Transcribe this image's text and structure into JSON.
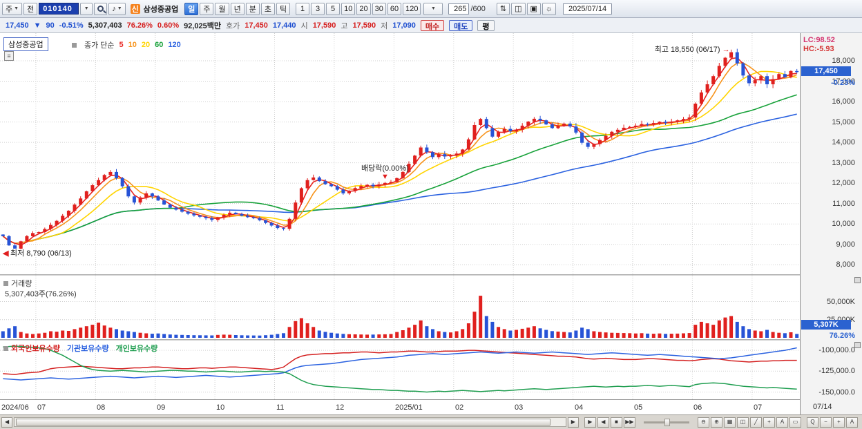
{
  "glyphs": {
    "dropdown": "▼",
    "speaker": "♪",
    "menu": "≡",
    "scroll_left": "◀",
    "scroll_right": "▶"
  },
  "toolbar": {
    "period_dropdown": "주",
    "prev_button": "전",
    "code": "010140",
    "flag_badge": "신",
    "stock_name": "삼성중공업",
    "periods": [
      "일",
      "주",
      "월",
      "년",
      "분",
      "초",
      "틱"
    ],
    "active_period": "일",
    "intervals": [
      "1",
      "3",
      "5",
      "10",
      "20",
      "30",
      "60",
      "120"
    ],
    "count": "265",
    "count_total": "/600",
    "date": "2025/07/14",
    "icons": [
      {
        "name": "compare-icon",
        "glyph": "⇅"
      },
      {
        "name": "chart-type-icon",
        "glyph": "◫"
      },
      {
        "name": "save-icon",
        "glyph": "▣"
      },
      {
        "name": "settings-gear-icon",
        "glyph": "☼"
      }
    ]
  },
  "quotebar": {
    "price": "17,450",
    "arrow": "▼",
    "change": "90",
    "change_pct": "-0.51%",
    "volume": "5,307,403",
    "vol_ratio": "76.26%",
    "turnover_pct": "0.60%",
    "value": "92,025백만",
    "hoga_label": "호가",
    "ask": "17,450",
    "bid": "17,440",
    "open_label": "시",
    "open": "17,590",
    "high_label": "고",
    "high": "17,590",
    "low_label": "저",
    "low": "17,090",
    "buy_label": "매수",
    "sell_label": "매도",
    "avg_label": "평"
  },
  "panes": {
    "price": {
      "title": "삼성중공업",
      "legend_label": "종가 단순"
    },
    "volume": {
      "title": "거래량",
      "subtitle": "5,307,403주(76.26%)"
    },
    "ownership": {
      "legends": [
        "외국인보유수량",
        "기관보유수량",
        "개인보유수량"
      ]
    }
  },
  "indicators": {
    "lc": "LC:98.52",
    "lc_color": "#d4326e",
    "hc": "HC:-5.93",
    "hc_color": "#d43232"
  },
  "axis_boxes": {
    "price": {
      "raw": 17450,
      "value": "17,450",
      "pct": "-0.23%"
    },
    "volume": {
      "raw": 5307,
      "value": "5,307K",
      "pct": "76.26%"
    }
  },
  "bottombar": {
    "nav": [
      {
        "name": "play-button",
        "glyph": "▶"
      },
      {
        "name": "step-back-button",
        "glyph": "◀"
      },
      {
        "name": "stop-button",
        "glyph": "■"
      },
      {
        "name": "step-forward-button",
        "glyph": "▶▶"
      }
    ],
    "tools": [
      {
        "name": "zoom-out-range-icon",
        "glyph": "⊖"
      },
      {
        "name": "zoom-in-range-icon",
        "glyph": "⊕"
      },
      {
        "name": "grid-icon",
        "glyph": "▦"
      },
      {
        "name": "chart-style-icon",
        "glyph": "◫"
      },
      {
        "name": "trendline-icon",
        "glyph": "╱"
      },
      {
        "name": "crosshair-icon",
        "glyph": "+"
      },
      {
        "name": "text-tool-icon",
        "glyph": "A"
      },
      {
        "name": "shape-tool-icon",
        "glyph": "▭"
      }
    ],
    "zoom": [
      {
        "name": "magnifier-button",
        "glyph": "Q"
      },
      {
        "name": "zoom-out-button",
        "glyph": "−"
      },
      {
        "name": "zoom-in-button",
        "glyph": "+"
      },
      {
        "name": "auto-scale-button",
        "glyph": "A"
      }
    ]
  },
  "chart_data": {
    "type": "candlestick",
    "panes": [
      "candlestick+moving-averages",
      "volume-bars",
      "ownership-lines"
    ],
    "symbol": "삼성중공업",
    "code": "010140",
    "last_date": "07/14",
    "price_axis": {
      "min": 7600,
      "max": 18950,
      "ticks": [
        8000,
        9000,
        10000,
        11000,
        12000,
        13000,
        14000,
        15000,
        16000,
        17000,
        18000
      ]
    },
    "volume_axis": {
      "max": 80000,
      "ticks": [
        25000,
        50000
      ]
    },
    "ownership_axis": {
      "min": -157000,
      "max": -90000,
      "ticks": [
        -100000,
        -125000,
        -150000
      ],
      "tick_labels": [
        "-100,000.0",
        "-125,000.0",
        "-150,000.0"
      ]
    },
    "months": [
      {
        "label": "2024/06",
        "start": 0
      },
      {
        "label": "07",
        "start": 6
      },
      {
        "label": "08",
        "start": 16
      },
      {
        "label": "09",
        "start": 26
      },
      {
        "label": "10",
        "start": 36
      },
      {
        "label": "11",
        "start": 46
      },
      {
        "label": "12",
        "start": 56
      },
      {
        "label": "2025/01",
        "start": 66
      },
      {
        "label": "02",
        "start": 76
      },
      {
        "label": "03",
        "start": 86
      },
      {
        "label": "04",
        "start": 96
      },
      {
        "label": "05",
        "start": 106
      },
      {
        "label": "06",
        "start": 116
      },
      {
        "label": "07",
        "start": 126
      }
    ],
    "open_first": 9480,
    "closes": [
      9400,
      8950,
      8790,
      9150,
      9400,
      9550,
      9600,
      9750,
      9950,
      10150,
      10400,
      10650,
      10950,
      11250,
      11600,
      11900,
      12150,
      12400,
      12550,
      12250,
      11850,
      11350,
      11050,
      11300,
      11500,
      11350,
      11150,
      10950,
      10800,
      10700,
      10600,
      10500,
      10420,
      10350,
      10280,
      10200,
      10320,
      10450,
      10550,
      10480,
      10400,
      10330,
      10280,
      10180,
      10050,
      9920,
      9800,
      9760,
      10250,
      11050,
      11750,
      12150,
      12280,
      12100,
      11950,
      11850,
      11680,
      11500,
      11620,
      11760,
      11860,
      11920,
      11850,
      11940,
      12010,
      12060,
      12250,
      12550,
      12950,
      13350,
      13750,
      13520,
      13280,
      13420,
      13310,
      13360,
      13450,
      13650,
      14150,
      14850,
      15150,
      14700,
      14280,
      14520,
      14660,
      14540,
      14620,
      14820,
      15020,
      15160,
      15080,
      14880,
      14700,
      14820,
      14920,
      14780,
      14480,
      13980,
      13780,
      13920,
      14120,
      14320,
      14520,
      14620,
      14720,
      14760,
      14820,
      14900,
      14860,
      14950,
      15010,
      14960,
      15020,
      15080,
      15150,
      15220,
      15900,
      16450,
      16850,
      17250,
      17750,
      18150,
      18420,
      17880,
      17280,
      16900,
      17050,
      17250,
      16850,
      17100,
      17350,
      17200,
      17500,
      17450
    ],
    "high_override": {
      "122": 18550
    },
    "low_override": {
      "2": 8790
    },
    "volumes_k": [
      9000,
      13000,
      16000,
      8000,
      6000,
      5200,
      6000,
      7000,
      9000,
      8500,
      10000,
      9500,
      12000,
      14000,
      16000,
      18000,
      21000,
      17000,
      14000,
      12000,
      10000,
      9000,
      8000,
      7000,
      6200,
      5600,
      6000,
      5200,
      4600,
      4200,
      4000,
      3800,
      3600,
      3500,
      3400,
      3300,
      4000,
      4400,
      4200,
      3800,
      3500,
      3300,
      3200,
      3100,
      3600,
      4200,
      5200,
      6400,
      15000,
      23000,
      27000,
      20000,
      15000,
      10000,
      8200,
      7000,
      6000,
      5400,
      5000,
      4800,
      4600,
      4400,
      4500,
      4700,
      4900,
      5200,
      8000,
      10500,
      14000,
      18000,
      24000,
      16000,
      12000,
      9000,
      8000,
      7400,
      9000,
      12000,
      20000,
      36000,
      58000,
      30000,
      22000,
      15000,
      12000,
      10000,
      11000,
      12500,
      14000,
      16000,
      13000,
      11000,
      9200,
      8600,
      8000,
      7400,
      10000,
      14000,
      12000,
      9000,
      8000,
      7400,
      7000,
      6800,
      6600,
      6400,
      6000,
      6400,
      5800,
      5600,
      6000,
      5400,
      5600,
      5800,
      6200,
      6600,
      18000,
      22000,
      20000,
      18000,
      24000,
      28000,
      30000,
      22000,
      16000,
      12000,
      10000,
      9000,
      11000,
      8000,
      7000,
      6400,
      7600,
      5307
    ],
    "ownership": {
      "foreign": [
        -128000,
        -128500,
        -129000,
        -128000,
        -127000,
        -126500,
        -126000,
        -124000,
        -122000,
        -121000,
        -120500,
        -120000,
        -119500,
        -119000,
        -119500,
        -120000,
        -120500,
        -121000,
        -121500,
        -122000,
        -122000,
        -121500,
        -121000,
        -121000,
        -120500,
        -120000,
        -120000,
        -120500,
        -121000,
        -121500,
        -122000,
        -122000,
        -121500,
        -121000,
        -121000,
        -121500,
        -121000,
        -120500,
        -120000,
        -120000,
        -120500,
        -121000,
        -121500,
        -122000,
        -122500,
        -123000,
        -122000,
        -120000,
        -115000,
        -110000,
        -107000,
        -105500,
        -105000,
        -104500,
        -104000,
        -104000,
        -103500,
        -103000,
        -103000,
        -102500,
        -102000,
        -102000,
        -102500,
        -103000,
        -102500,
        -102000,
        -102000,
        -101500,
        -101000,
        -101000,
        -101500,
        -102000,
        -102000,
        -101500,
        -101000,
        -101000,
        -101000,
        -100500,
        -100000,
        -100000,
        -100500,
        -101000,
        -101500,
        -102000,
        -102500,
        -103000,
        -103500,
        -104000,
        -104500,
        -105000,
        -105500,
        -106000,
        -106500,
        -107000,
        -107000,
        -107500,
        -108000,
        -109000,
        -110000,
        -110500,
        -110000,
        -109500,
        -110000,
        -110500,
        -111000,
        -111000,
        -111000,
        -110500,
        -110000,
        -110000,
        -110500,
        -111000,
        -111500,
        -112000,
        -112000,
        -112500,
        -112000,
        -111000,
        -110500,
        -110000,
        -110500,
        -111500,
        -112500,
        -113000,
        -113500,
        -114000,
        -113500,
        -113000,
        -113000,
        -112500,
        -112500,
        -112000,
        -112000,
        -112000
      ],
      "institution": [
        -134000,
        -134500,
        -135000,
        -135500,
        -135000,
        -134500,
        -134000,
        -133500,
        -133000,
        -133500,
        -134000,
        -134500,
        -134000,
        -133500,
        -133000,
        -132500,
        -132000,
        -131500,
        -131000,
        -131500,
        -132000,
        -132500,
        -133000,
        -132500,
        -132000,
        -131500,
        -131000,
        -131500,
        -132000,
        -132500,
        -132000,
        -131500,
        -131000,
        -130500,
        -130000,
        -130500,
        -131000,
        -131500,
        -132000,
        -131500,
        -131000,
        -130500,
        -130000,
        -129500,
        -129000,
        -128500,
        -128000,
        -127000,
        -124000,
        -121000,
        -119000,
        -118000,
        -117500,
        -117000,
        -116500,
        -116000,
        -115000,
        -114000,
        -113000,
        -112000,
        -111000,
        -110500,
        -110000,
        -109500,
        -109000,
        -108500,
        -108000,
        -107000,
        -106000,
        -105500,
        -105000,
        -104500,
        -104000,
        -104500,
        -105000,
        -104500,
        -104000,
        -103500,
        -103000,
        -102500,
        -102000,
        -102500,
        -103000,
        -103500,
        -103000,
        -102500,
        -102000,
        -102500,
        -103000,
        -103500,
        -103000,
        -102500,
        -102000,
        -102500,
        -103000,
        -103500,
        -104000,
        -104500,
        -105000,
        -104500,
        -104000,
        -103500,
        -103000,
        -103500,
        -104000,
        -104500,
        -105000,
        -105500,
        -106000,
        -105500,
        -105000,
        -105500,
        -106000,
        -106500,
        -107000,
        -107500,
        -108000,
        -108500,
        -109000,
        -109500,
        -110000,
        -109500,
        -109000,
        -108000,
        -107000,
        -106000,
        -105000,
        -104000,
        -103000,
        -102000,
        -101000,
        -100000,
        -98500,
        -97000
      ],
      "individual": [
        -96000,
        -95500,
        -95000,
        -95500,
        -96000,
        -96500,
        -97000,
        -98000,
        -100000,
        -103000,
        -106000,
        -110000,
        -114000,
        -118000,
        -121000,
        -123000,
        -124000,
        -124500,
        -125000,
        -124500,
        -124000,
        -124500,
        -125000,
        -125500,
        -126000,
        -125500,
        -125000,
        -124500,
        -124000,
        -124000,
        -124500,
        -125000,
        -125000,
        -125500,
        -126000,
        -125500,
        -125000,
        -125000,
        -125500,
        -126000,
        -126000,
        -125500,
        -125000,
        -125000,
        -125500,
        -125000,
        -125500,
        -126000,
        -128000,
        -132000,
        -136000,
        -139000,
        -141000,
        -142000,
        -143000,
        -143500,
        -144000,
        -144500,
        -145000,
        -145500,
        -146000,
        -146500,
        -147000,
        -147000,
        -147500,
        -148000,
        -148000,
        -148500,
        -149000,
        -149000,
        -149500,
        -150000,
        -149500,
        -149000,
        -149500,
        -149000,
        -148500,
        -148000,
        -148500,
        -149000,
        -149500,
        -149000,
        -148500,
        -148000,
        -148500,
        -148000,
        -147500,
        -147000,
        -146500,
        -146000,
        -146500,
        -147000,
        -146500,
        -146000,
        -145500,
        -145000,
        -144500,
        -144000,
        -143500,
        -143000,
        -143500,
        -144000,
        -143500,
        -143000,
        -143500,
        -143000,
        -143000,
        -142500,
        -142000,
        -142500,
        -143000,
        -142500,
        -142000,
        -142500,
        -143000,
        -143500,
        -141000,
        -140000,
        -139500,
        -139000,
        -139500,
        -140000,
        -141000,
        -142000,
        -143000,
        -143500,
        -144000,
        -144500,
        -145000,
        -144500,
        -145000,
        -145500,
        -146000,
        -146500
      ]
    },
    "ma": {
      "series": [
        {
          "label": "5",
          "window": 3,
          "color": "#e8231f"
        },
        {
          "label": "10",
          "window": 5,
          "color": "#f7941d"
        },
        {
          "label": "20",
          "window": 10,
          "color": "#ffd400"
        },
        {
          "label": "60",
          "window": 30,
          "color": "#18a23a"
        },
        {
          "label": "120",
          "window": 60,
          "color": "#2b62e0"
        }
      ]
    },
    "colors": {
      "up": "#e0201e",
      "down": "#2753d6",
      "foreign": "#d42020",
      "institution": "#2b62e0",
      "individual": "#1f9e50"
    },
    "annotations": {
      "high": "최고 18,550 (06/17)",
      "high_index": 122,
      "low": "최저 8,790 (06/13)",
      "low_index": 2,
      "event": "배당락(0.00%)",
      "event_index": 64
    }
  }
}
